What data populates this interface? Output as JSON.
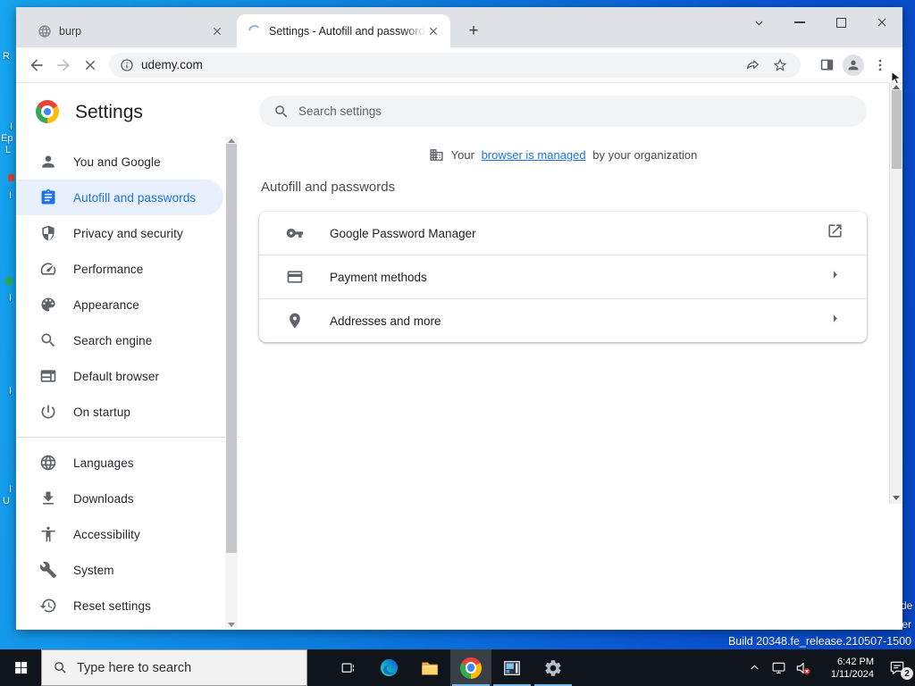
{
  "colors": {
    "accent": "#1a73e8",
    "selected_bg": "#e8f0fe",
    "taskbar_underline": "#76b9ed",
    "desktop_blue_left": "#16a5f0",
    "desktop_blue_right": "#0744c2",
    "chrome_red": "#ea4335",
    "chrome_yellow": "#fbbc04",
    "chrome_green": "#34a853",
    "chrome_blue": "#4285f4"
  },
  "browser": {
    "tabs": [
      {
        "title": "burp"
      },
      {
        "title": "Settings - Autofill and passwords"
      }
    ],
    "new_tab_glyph": "+",
    "url": "udemy.com"
  },
  "settings": {
    "title": "Settings",
    "search_placeholder": "Search settings",
    "managed_prefix": "Your",
    "managed_link": "browser is managed",
    "managed_suffix": "by your organization",
    "section_title": "Autofill and passwords",
    "nav": [
      {
        "label": "You and Google"
      },
      {
        "label": "Autofill and passwords"
      },
      {
        "label": "Privacy and security"
      },
      {
        "label": "Performance"
      },
      {
        "label": "Appearance"
      },
      {
        "label": "Search engine"
      },
      {
        "label": "Default browser"
      },
      {
        "label": "On startup"
      },
      {
        "label": "Languages"
      },
      {
        "label": "Downloads"
      },
      {
        "label": "Accessibility"
      },
      {
        "label": "System"
      },
      {
        "label": "Reset settings"
      }
    ],
    "rows": [
      {
        "label": "Google Password Manager"
      },
      {
        "label": "Payment methods"
      },
      {
        "label": "Addresses and more"
      }
    ]
  },
  "taskbar": {
    "search_placeholder": "Type here to search",
    "clock_time": "6:42 PM",
    "clock_date": "1/11/2024",
    "notification_badge": "2"
  },
  "desktop": {
    "build_text": "Build 20348.fe_release.210507-1500",
    "fragments": [
      {
        "text": "R"
      },
      {
        "text": "I"
      },
      {
        "text": "Ep"
      },
      {
        "text": "L"
      },
      {
        "text": "I"
      },
      {
        "text": "I"
      },
      {
        "text": "I"
      },
      {
        "text": "I"
      },
      {
        "text": "U"
      },
      {
        "text": "de"
      },
      {
        "text": "ter"
      }
    ]
  }
}
